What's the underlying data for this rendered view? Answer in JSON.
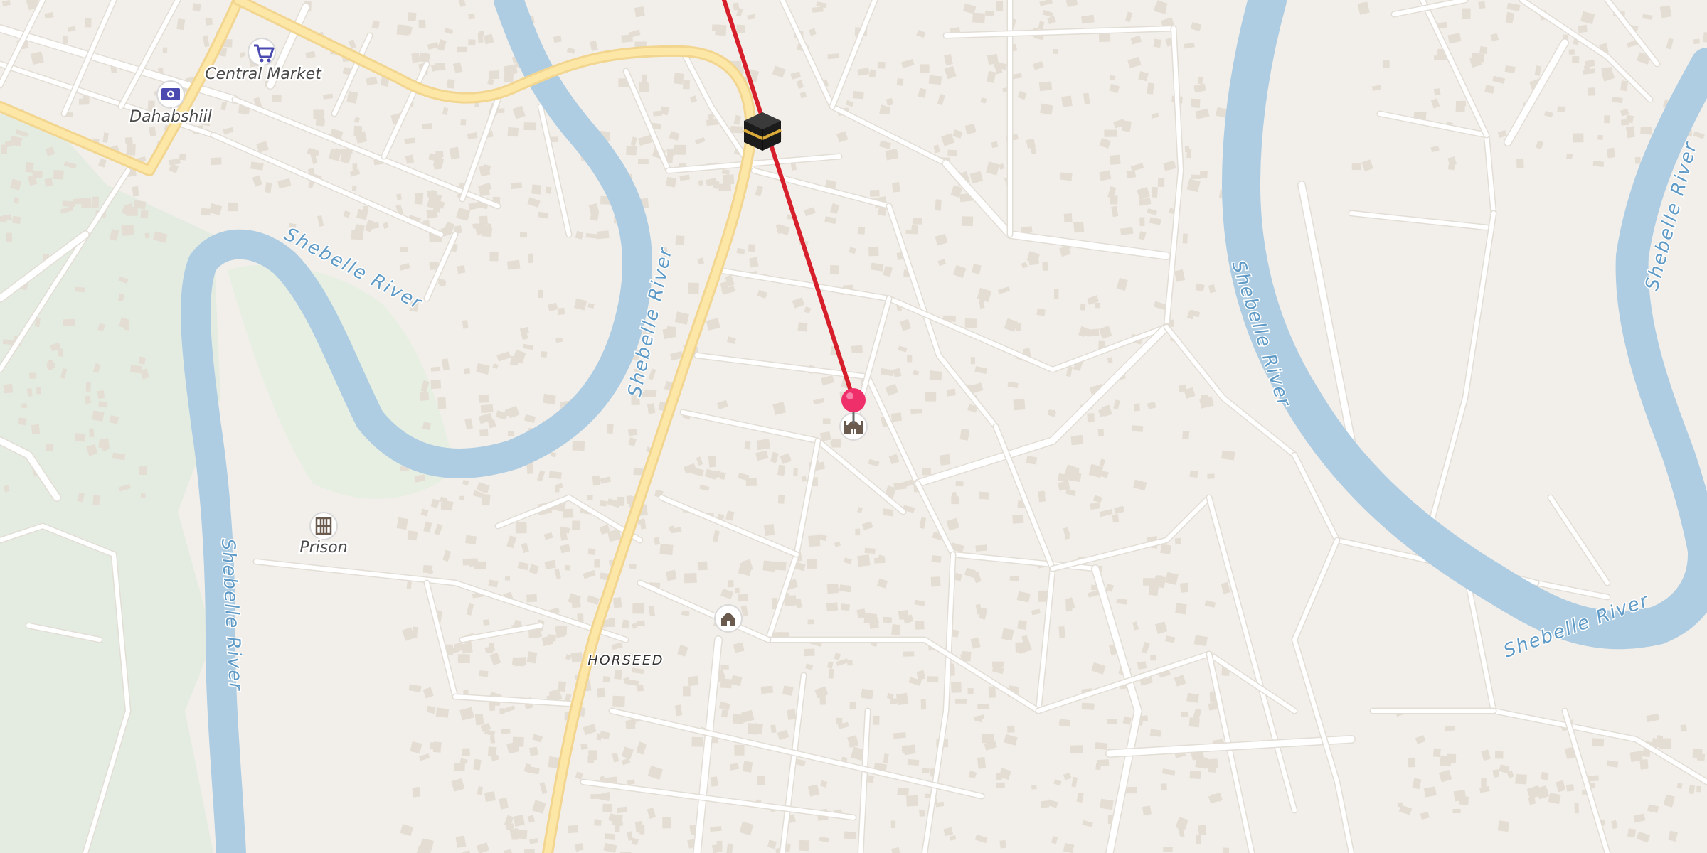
{
  "map": {
    "land_color": "#f2efea",
    "water_color": "#aecde3",
    "park_color": "#e4ece1",
    "route_color": "#d71f2c",
    "pin_color": "#ee2f6a"
  },
  "places": {
    "central_market": {
      "label": "Central Market",
      "icon": "shopping-cart-icon"
    },
    "dahabshiil": {
      "label": "Dahabshiil",
      "icon": "money-exchange-icon"
    },
    "prison": {
      "label": "Prison",
      "icon": "prison-icon"
    },
    "horseed": {
      "label": "HORSEED"
    },
    "kaaba": {
      "icon": "kaaba-icon"
    },
    "mosque_pin": {
      "icon": "mosque-icon"
    },
    "mosque_2": {
      "icon": "mosque-icon"
    }
  },
  "rivers": [
    {
      "label": "Shebelle River"
    },
    {
      "label": "Shebelle River"
    },
    {
      "label": "Shebelle River"
    },
    {
      "label": "Shebelle River"
    },
    {
      "label": "Shebelle River"
    },
    {
      "label": "Shebelle River"
    }
  ]
}
